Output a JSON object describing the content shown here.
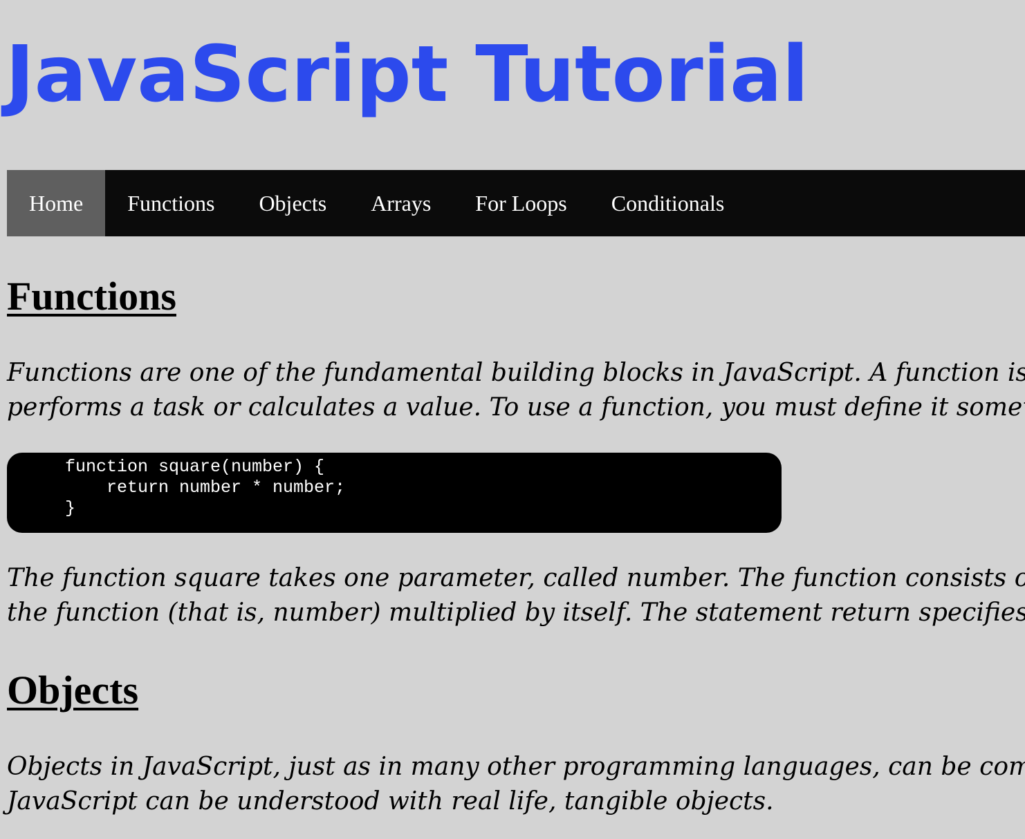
{
  "header": {
    "title": "JavaScript Tutorial"
  },
  "nav": {
    "items": [
      {
        "label": "Home",
        "active": true
      },
      {
        "label": "Functions",
        "active": false
      },
      {
        "label": "Objects",
        "active": false
      },
      {
        "label": "Arrays",
        "active": false
      },
      {
        "label": "For Loops",
        "active": false
      },
      {
        "label": "Conditionals",
        "active": false
      }
    ]
  },
  "sections": {
    "functions": {
      "heading": "Functions",
      "intro_lines": [
        "Functions are one of the fundamental building blocks in JavaScript. A function is a",
        "performs a task or calculates a value. To use a function, you must define it somewh"
      ],
      "code_lines": [
        "function square(number) {",
        "    return number * number;",
        "}"
      ],
      "explanation_lines": [
        "The function square takes one parameter, called number. The function consists of o",
        "the function (that is, number) multiplied by itself. The statement return specifies th"
      ]
    },
    "objects": {
      "heading": "Objects",
      "intro_lines": [
        "Objects in JavaScript, just as in many other programming languages, can be compa",
        "JavaScript can be understood with real life, tangible objects."
      ]
    }
  },
  "colors": {
    "background": "#d3d3d3",
    "title": "#2c4aed",
    "navbar": "#0b0b0b",
    "nav_active": "#5f5f5f",
    "code_background": "#000000"
  }
}
